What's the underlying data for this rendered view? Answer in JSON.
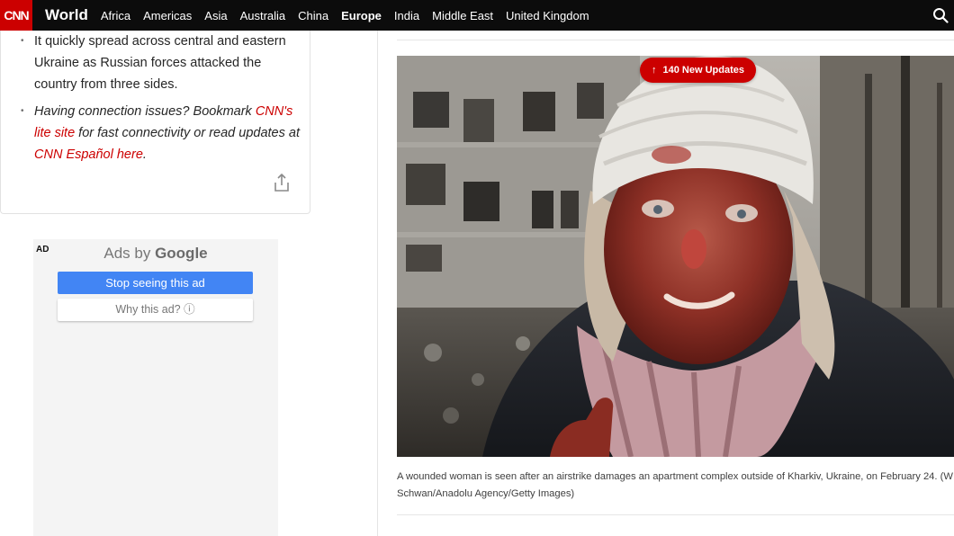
{
  "header": {
    "logo": "CNN",
    "edition": "World",
    "nav_items": [
      "Africa",
      "Americas",
      "Asia",
      "Australia",
      "China",
      "Europe",
      "India",
      "Middle East",
      "United Kingdom"
    ],
    "active_item": "Europe"
  },
  "story": {
    "bullet_1": "It quickly spread across central and eastern Ukraine as Russian forces attacked the country from three sides.",
    "bullet_2": {
      "part_1": "Having connection issues? Bookmark ",
      "link_1": "CNN's lite site",
      "part_2": " for fast connectivity or read updates at ",
      "link_2": "CNN Español here",
      "part_3": "."
    }
  },
  "ad": {
    "label": "AD",
    "ads_by_prefix": "Ads by ",
    "ads_by_brand": "Google",
    "stop_button": "Stop seeing this ad",
    "why_button": "Why this ad? ⓘ"
  },
  "live": {
    "updates_label": "140 New Updates",
    "caption_line_1": "A wounded woman is seen after an airstrike damages an apartment complex outside of Kharkiv, Ukraine, on February 24. (W",
    "caption_line_2": "Schwan/Anadolu Agency/Getty Images)"
  },
  "colors": {
    "brand_red": "#cc0000",
    "nav_bg": "#0c0c0c",
    "google_blue": "#4285f4"
  }
}
